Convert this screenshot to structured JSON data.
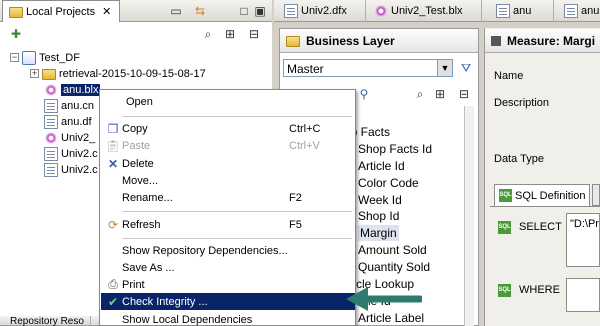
{
  "left_panel": {
    "title": "Local Projects",
    "tree": [
      {
        "label": "Test_DF"
      },
      {
        "label": "retrieval-2015-10-09-15-08-17"
      },
      {
        "label": "anu.blx"
      },
      {
        "label": "anu.cn"
      },
      {
        "label": "anu.df"
      },
      {
        "label": "Univ2_"
      },
      {
        "label": "Univ2.c"
      },
      {
        "label": "Univ2.c"
      }
    ],
    "bottom_tab": "Repository Reso"
  },
  "editor_tabs": [
    "Univ2.dfx",
    "Univ2_Test.blx",
    "anu",
    "anu"
  ],
  "business_layer": {
    "title": "Business Layer",
    "dropdown_value": "Master",
    "items": [
      "op Facts",
      "Shop Facts Id",
      "Article Id",
      "Color Code",
      "Week Id",
      "Shop Id",
      "Margin",
      "Amount Sold",
      "Quantity Sold",
      "ticle Lookup",
      "rticle Id",
      "Article Label"
    ],
    "highlighted_item": "Margin"
  },
  "measure": {
    "title": "Measure: Margi",
    "labels": {
      "name": "Name",
      "description": "Description",
      "data_type": "Data Type"
    },
    "sql_tab": "SQL Definition",
    "select_label": "SELECT",
    "select_value": "\"D:\\Pr",
    "where_label": "WHERE"
  },
  "context_menu": {
    "items": [
      {
        "label": "Open",
        "key": "",
        "icon": "",
        "disabled": false
      },
      {
        "label": "Copy",
        "key": "Ctrl+C",
        "icon": "copy-icon",
        "disabled": false
      },
      {
        "label": "Paste",
        "key": "Ctrl+V",
        "icon": "paste-icon",
        "disabled": true
      },
      {
        "label": "Delete",
        "key": "",
        "icon": "delete-icon",
        "disabled": false
      },
      {
        "label": "Move...",
        "key": "",
        "icon": "",
        "disabled": false
      },
      {
        "label": "Rename...",
        "key": "F2",
        "icon": "",
        "disabled": false
      },
      {
        "label": "Refresh",
        "key": "F5",
        "icon": "refresh-icon",
        "disabled": false
      },
      {
        "label": "Show Repository Dependencies...",
        "key": "",
        "icon": "",
        "disabled": false
      },
      {
        "label": "Save As ...",
        "key": "",
        "icon": "",
        "disabled": false
      },
      {
        "label": "Print",
        "key": "",
        "icon": "print-icon",
        "disabled": false
      },
      {
        "label": "Check Integrity ...",
        "key": "",
        "icon": "check-integrity-icon",
        "disabled": false,
        "active": true
      },
      {
        "label": "Show Local Dependencies",
        "key": "",
        "icon": "",
        "disabled": false
      }
    ]
  },
  "colors": {
    "selection": "#0a246a",
    "arrow": "#2e7a6e"
  }
}
